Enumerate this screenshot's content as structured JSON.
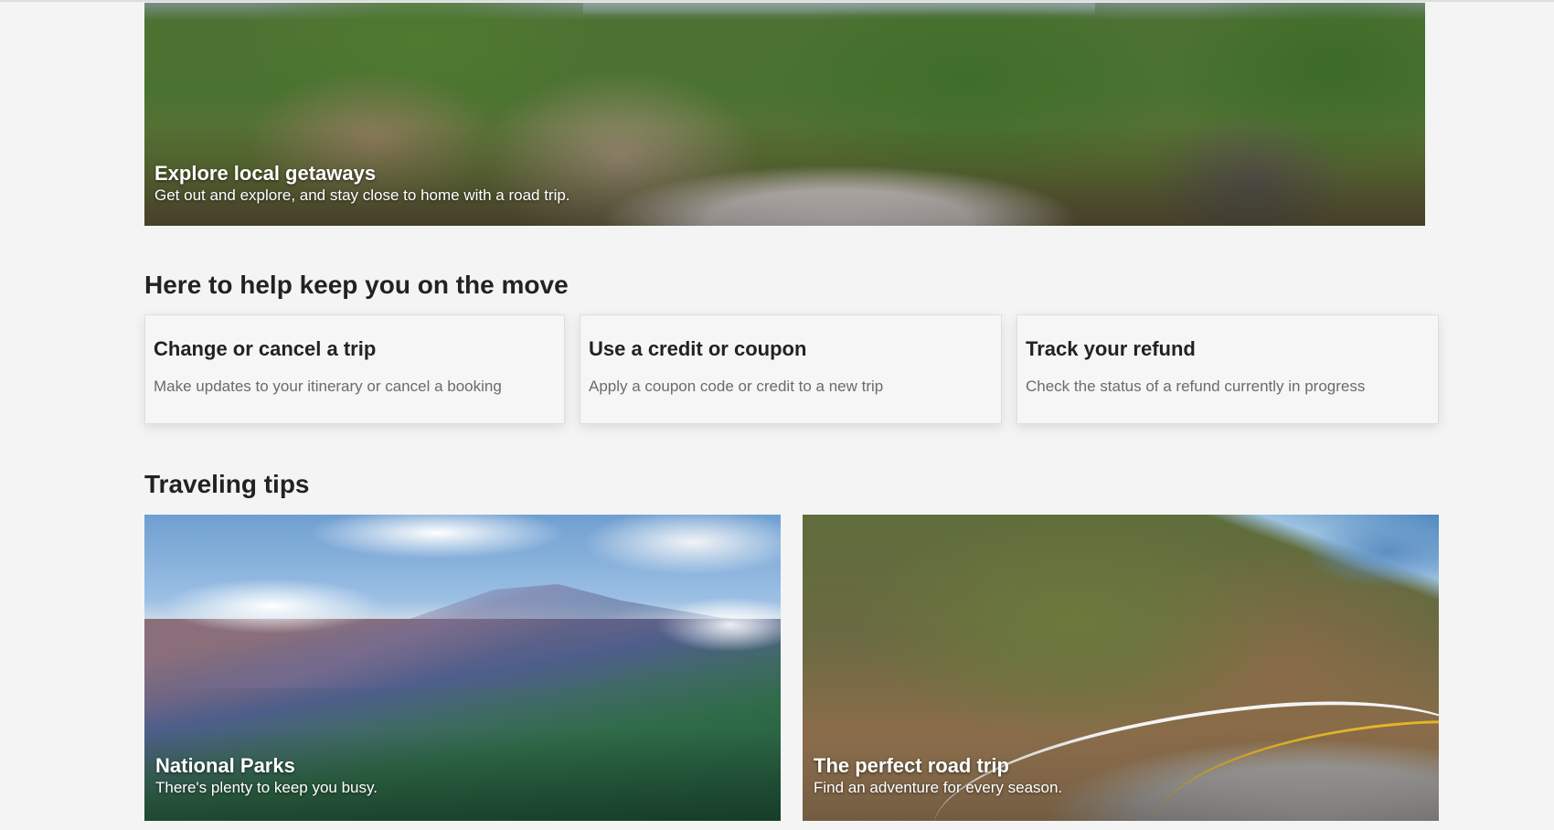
{
  "hero": {
    "title": "Explore local getaways",
    "subtitle": "Get out and explore, and stay close to home with a road trip."
  },
  "help_section": {
    "heading": "Here to help keep you on the move",
    "cards": [
      {
        "title": "Change or cancel a trip",
        "description": "Make updates to your itinerary or cancel a booking"
      },
      {
        "title": "Use a credit or coupon",
        "description": "Apply a coupon code or credit to a new trip"
      },
      {
        "title": "Track your refund",
        "description": "Check the status of a refund currently in progress"
      }
    ]
  },
  "tips_section": {
    "heading": "Traveling tips",
    "cards": [
      {
        "title": "National Parks",
        "subtitle": "There's plenty to keep you busy."
      },
      {
        "title": "The perfect road trip",
        "subtitle": "Find an adventure for every season."
      }
    ]
  }
}
